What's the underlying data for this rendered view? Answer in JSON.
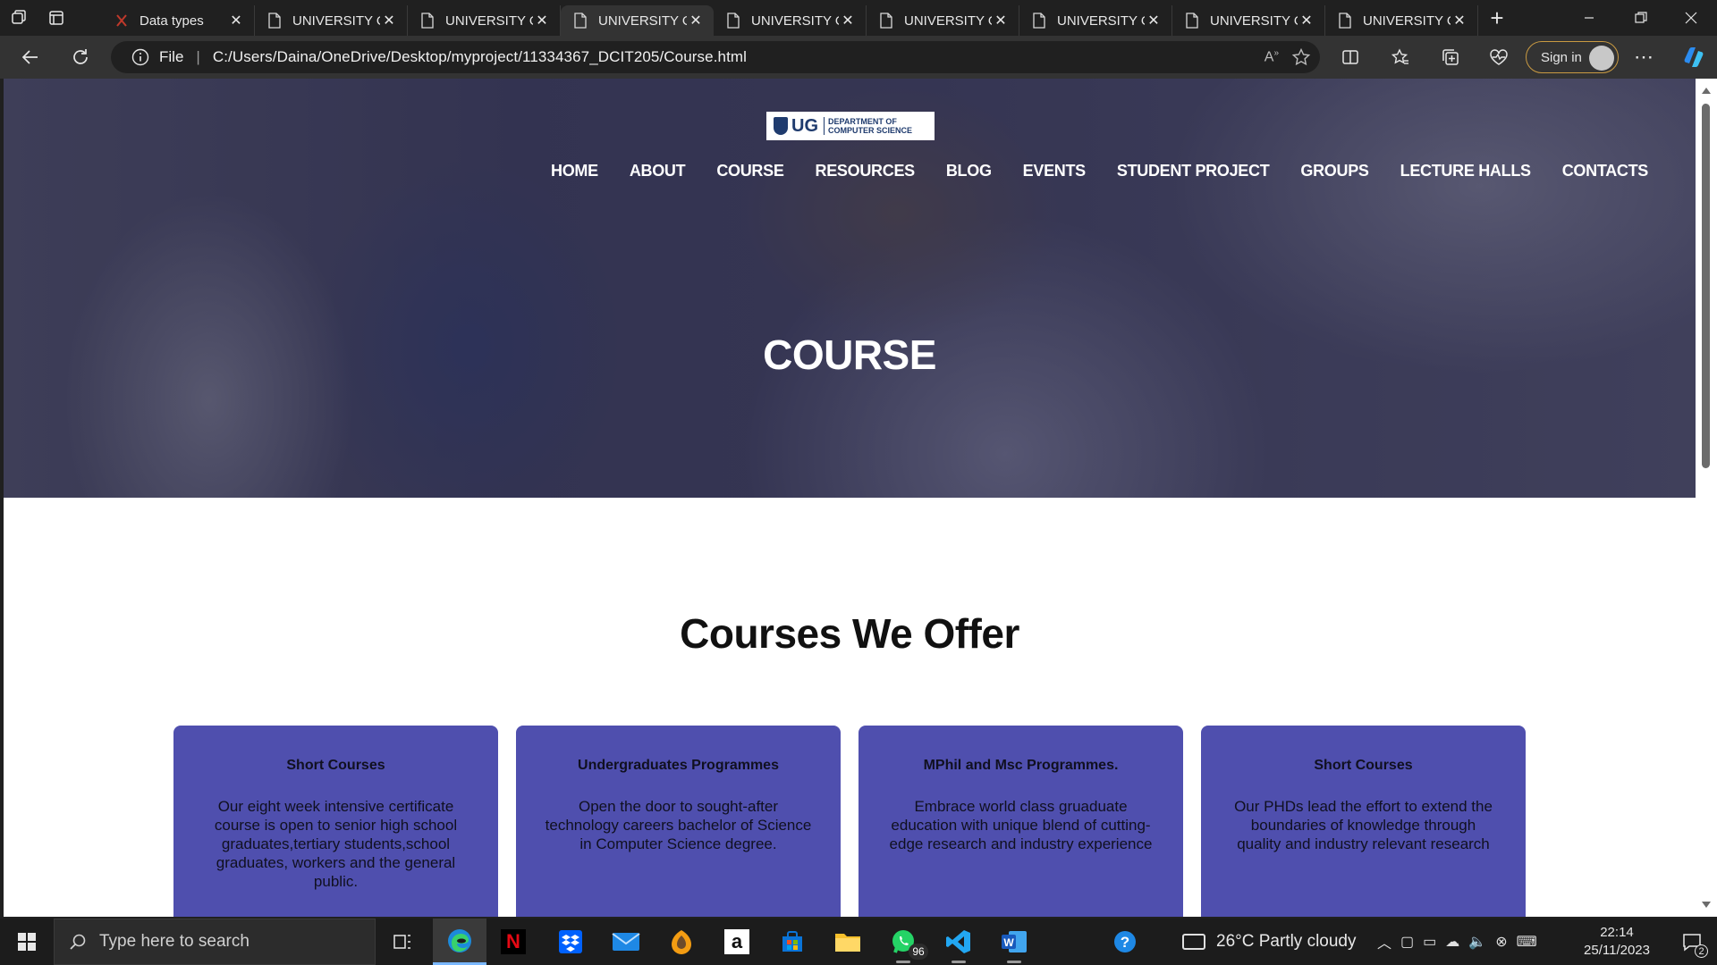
{
  "browser": {
    "tabs": [
      {
        "title": "Data types",
        "favicon": "x-icon",
        "active": false
      },
      {
        "title": "UNIVERSITY O",
        "favicon": "page-icon",
        "active": false
      },
      {
        "title": "UNIVERSITY O",
        "favicon": "page-icon",
        "active": false
      },
      {
        "title": "UNIVERSITY O",
        "favicon": "page-icon",
        "active": true
      },
      {
        "title": "UNIVERSITY O",
        "favicon": "page-icon",
        "active": false
      },
      {
        "title": "UNIVERSITY O",
        "favicon": "page-icon",
        "active": false
      },
      {
        "title": "UNIVERSITY O",
        "favicon": "page-icon",
        "active": false
      },
      {
        "title": "UNIVERSITY O",
        "favicon": "page-icon",
        "active": false
      },
      {
        "title": "UNIVERSITY O",
        "favicon": "page-icon",
        "active": false
      }
    ],
    "address": {
      "scheme_label": "File",
      "separator": "|",
      "url": "C:/Users/Daina/OneDrive/Desktop/myproject/11334367_DCIT205/Course.html"
    },
    "sign_in_label": "Sign in"
  },
  "page": {
    "logo": {
      "short": "UG",
      "line1": "DEPARTMENT OF",
      "line2": "COMPUTER SCIENCE"
    },
    "nav": [
      "HOME",
      "ABOUT",
      "COURSE",
      "RESOURCES",
      "BLOG",
      "EVENTS",
      "STUDENT PROJECT",
      "GROUPS",
      "LECTURE HALLS",
      "CONTACTS"
    ],
    "hero_title": "COURSE",
    "section_title": "Courses We Offer",
    "cards": [
      {
        "title": "Short Courses",
        "body": "Our eight week intensive certificate course is open to senior high school graduates,tertiary students,school graduates, workers and the general public."
      },
      {
        "title": "Undergraduates Programmes",
        "body": "Open the door to sought-after technology careers bachelor of Science in Computer Science degree."
      },
      {
        "title": "MPhil and Msc Programmes.",
        "body": "Embrace world class gruaduate education with unique blend of cutting-edge research and industry experience"
      },
      {
        "title": "Short Courses",
        "body": "Our PHDs lead the effort to extend the boundaries of knowledge through quality and industry relevant research"
      }
    ],
    "card_color": "#4f4fae"
  },
  "taskbar": {
    "search_placeholder": "Type here to search",
    "whatsapp_badge": "96",
    "weather": "26°C  Partly cloudy",
    "time": "22:14",
    "date": "25/11/2023",
    "notification_count": "2"
  }
}
